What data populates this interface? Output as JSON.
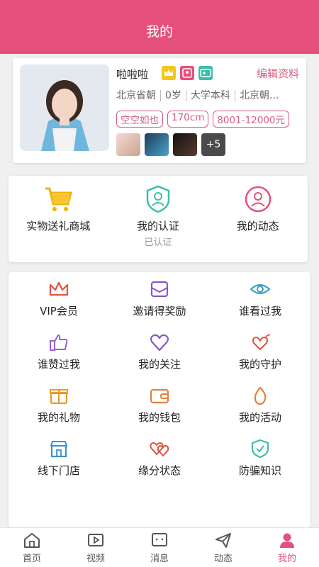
{
  "header": {
    "title": "我的"
  },
  "profile": {
    "name": "啦啦啦",
    "edit_label": "编辑资料",
    "info": [
      "北京省朝",
      "0岁",
      "大学本科",
      "北京朝..."
    ],
    "tags": [
      "空空如也",
      "170cm",
      "8001-12000元"
    ],
    "more_photos": "+5"
  },
  "services": [
    {
      "label": "实物送礼商城",
      "sub": "",
      "icon": "shopping-cart-icon"
    },
    {
      "label": "我的认证",
      "sub": "已认证",
      "icon": "shield-person-icon"
    },
    {
      "label": "我的动态",
      "sub": "",
      "icon": "camera-person-icon"
    }
  ],
  "menu": [
    {
      "label": "VIP会员",
      "icon": "crown-icon"
    },
    {
      "label": "邀请得奖励",
      "icon": "envelope-icon"
    },
    {
      "label": "谁看过我",
      "icon": "eye-icon"
    },
    {
      "label": "谁赞过我",
      "icon": "thumbs-up-icon"
    },
    {
      "label": "我的关注",
      "icon": "heart-icon"
    },
    {
      "label": "我的守护",
      "icon": "wings-icon"
    },
    {
      "label": "我的礼物",
      "icon": "gift-icon"
    },
    {
      "label": "我的钱包",
      "icon": "wallet-icon"
    },
    {
      "label": "我的活动",
      "icon": "flame-icon"
    },
    {
      "label": "线下门店",
      "icon": "store-icon"
    },
    {
      "label": "缘分状态",
      "icon": "double-heart-icon"
    },
    {
      "label": "防骗知识",
      "icon": "shield-check-icon"
    }
  ],
  "tabs": [
    {
      "label": "首页",
      "icon": "home-icon"
    },
    {
      "label": "视频",
      "icon": "video-icon"
    },
    {
      "label": "消息",
      "icon": "message-icon"
    },
    {
      "label": "动态",
      "icon": "send-icon"
    },
    {
      "label": "我的",
      "icon": "user-icon",
      "active": true
    }
  ],
  "colors": {
    "primary": "#e5507a",
    "accent_text": "#d25f7e"
  }
}
